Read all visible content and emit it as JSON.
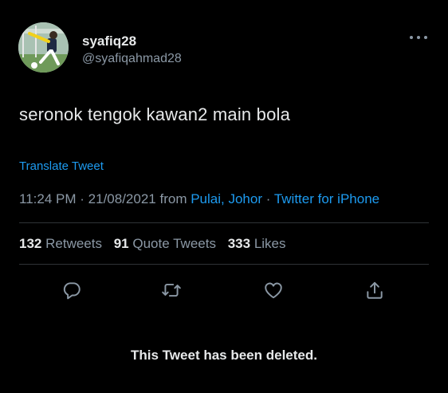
{
  "user": {
    "display_name": "syafiq28",
    "handle": "@syafiqahmad28"
  },
  "tweet": {
    "text": "seronok tengok kawan2 main bola",
    "translate_label": "Translate Tweet",
    "time": "11:24 PM",
    "date": "21/08/2021",
    "from_label": "from",
    "location": "Pulai, Johor",
    "source": "Twitter for iPhone",
    "separator": "·"
  },
  "stats": {
    "retweets_count": "132",
    "retweets_label": "Retweets",
    "quotes_count": "91",
    "quotes_label": "Quote Tweets",
    "likes_count": "333",
    "likes_label": "Likes"
  },
  "icons": {
    "more": "more-icon",
    "reply": "reply-icon",
    "retweet": "retweet-icon",
    "like": "heart-icon",
    "share": "share-icon"
  },
  "colors": {
    "background": "#000000",
    "text_primary": "#e7e9ea",
    "text_secondary": "#8b98a5",
    "accent": "#1d9bf0",
    "divider": "#2f3336"
  },
  "notice": "This Tweet has been deleted."
}
